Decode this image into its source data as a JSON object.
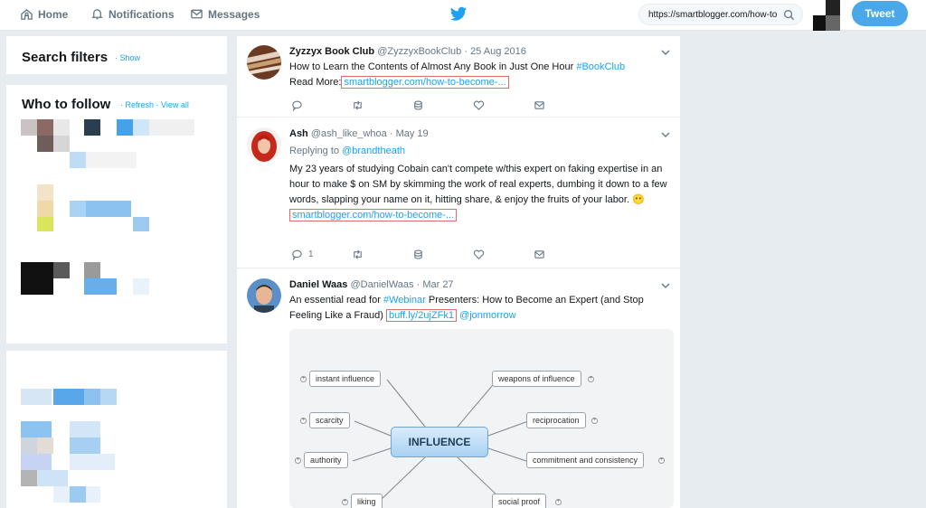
{
  "nav": {
    "home": "Home",
    "notifications": "Notifications",
    "messages": "Messages"
  },
  "search": {
    "value": "https://smartblogger.com/how-to"
  },
  "tweet_button": "Tweet",
  "sidebar": {
    "filters_title": "Search filters",
    "filters_show": "· Show",
    "follow_title": "Who to follow",
    "follow_links": "· Refresh · View all"
  },
  "tweets": [
    {
      "name": "Zyzzyx Book Club",
      "handle": "@ZyzzyxBookClub",
      "date": "· 25 Aug 2016",
      "text_plain": "How to Learn the Contents of Almost Any Book in Just One Hour",
      "hashtag": "#BookClub",
      "read_more": "Read More:",
      "link": "smartblogger.com/how-to-become-..."
    },
    {
      "name": "Ash",
      "handle": "@ash_like_whoa",
      "date": "· May 19",
      "replying_label": "Replying to",
      "replying_to": "@brandtheath",
      "text": "My 23 years of studying Cobain can't compete w/this expert on faking expertise in an hour to make $ on SM by skimming the work of real experts, dumbing it down to a few words, slapping your name on it, hitting share, & enjoy the fruits of your labor. 😶",
      "link": "smartblogger.com/how-to-become-...",
      "reply_count": "1"
    },
    {
      "name": "Daniel Waas",
      "handle": "@DanielWaas",
      "date": "· Mar 27",
      "text_a": "An essential read for",
      "hashtag": "#Webinar",
      "text_b": "Presenters: How to Become an Expert (and Stop Feeling Like a Fraud)",
      "link": "buff.ly/2ujZFk1",
      "mention": "@jonmorrow"
    }
  ],
  "mindmap": {
    "center": "INFLUENCE",
    "nodes": [
      "instant influence",
      "scarcity",
      "authority",
      "liking",
      "weapons of influence",
      "reciprocation",
      "commitment and consistency",
      "social proof"
    ]
  },
  "colors": {
    "accent": "#1da1f2",
    "tweet_button": "#4aa8e8",
    "page_bg": "#e6ecf0",
    "link_box": "#e06b6b"
  }
}
